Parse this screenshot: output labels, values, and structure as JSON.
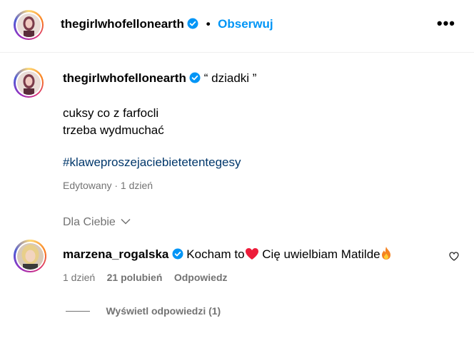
{
  "header": {
    "username": "thegirlwhofellonearth",
    "separator": "•",
    "follow_label": "Obserwuj",
    "more_label": "•••"
  },
  "caption": {
    "username": "thegirlwhofellonearth",
    "title": "“ dziadki ”",
    "lines": [
      "cuksy co z farfocli",
      "trzeba wydmuchać"
    ],
    "hashtag": "#klaweproszejaciebietetentegesy",
    "meta": "Edytowany · 1 dzień"
  },
  "filter": {
    "label": "Dla Ciebie"
  },
  "comment": {
    "username": "marzena_rogalska",
    "text_part1": "Kocham to",
    "text_part2": " Cię uwielbiam Matilde",
    "time": "1 dzień",
    "likes": "21 polubień",
    "reply_label": "Odpowiedz",
    "view_replies": "Wyświetl odpowiedzi (1)"
  },
  "colors": {
    "accent": "#0095f6",
    "hashtag": "#00376b",
    "muted": "#737373",
    "verified": "#0095f6",
    "heart": "#ed4956"
  },
  "icons": [
    "verified-badge-icon",
    "more-options-icon",
    "chevron-down-icon",
    "heart-emoji-icon",
    "fire-emoji-icon",
    "like-heart-icon"
  ]
}
